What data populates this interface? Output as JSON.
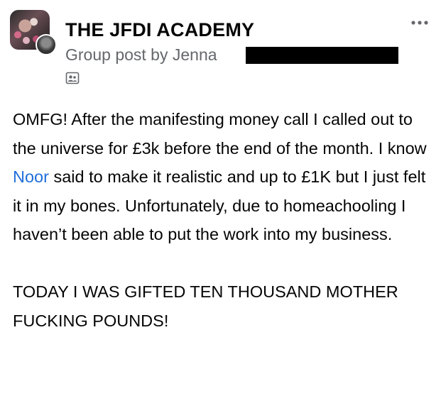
{
  "post": {
    "group_name": "THE JFDI ACADEMY",
    "byline_prefix": "Group post by Jenna",
    "body_line1_before": "OMFG! After the manifesting money call I called out to the universe for £3k before the end of the month. I know ",
    "mention": "Noor",
    "body_line1_after": " said to make it realistic and up to £1K but I just felt it in my bones. Unfortunately, due to homeachooling I haven’t been able to put the work into my business.",
    "body_paragraph2": "TODAY I WAS GIFTED TEN THOUSAND MOTHER FUCKING POUNDS!"
  },
  "icons": {
    "more": "more-horizontal-icon",
    "privacy": "group-members-icon"
  },
  "colors": {
    "mention": "#216fdb",
    "secondary_text": "#65676b"
  }
}
